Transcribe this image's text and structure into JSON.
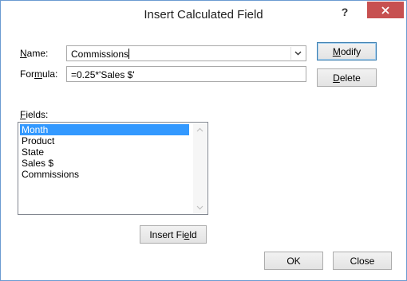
{
  "window": {
    "title": "Insert Calculated Field",
    "help_glyph": "?",
    "close_glyph": "✕"
  },
  "form": {
    "name_label_u": "N",
    "name_label_rest": "ame:",
    "name_value": "Commissions",
    "formula_label_pre": "For",
    "formula_label_u": "m",
    "formula_label_post": "ula:",
    "formula_value": "=0.25*'Sales $'"
  },
  "buttons": {
    "modify_u": "M",
    "modify_rest": "odify",
    "delete_u": "D",
    "delete_rest": "elete",
    "insert_field_pre": "Insert Fi",
    "insert_field_u": "e",
    "insert_field_post": "ld",
    "ok": "OK",
    "close": "Close"
  },
  "fields": {
    "label_u": "F",
    "label_rest": "ields:",
    "items": [
      "Month",
      "Product",
      "State",
      "Sales $",
      "Commissions"
    ],
    "selected_index": 0
  },
  "icons": {
    "dropdown": "chevron-down-icon",
    "scroll_up": "chevron-up-icon",
    "scroll_down": "chevron-down-icon",
    "close": "close-icon",
    "help": "help-icon"
  },
  "colors": {
    "selection": "#3399ff",
    "close_button": "#c75050",
    "window_border": "#6b9bd1"
  }
}
